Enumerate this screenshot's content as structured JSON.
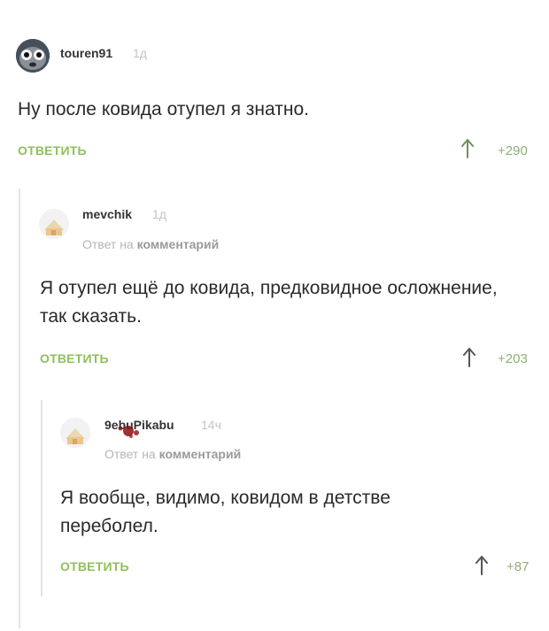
{
  "comments": [
    {
      "username": "touren91",
      "time": "1д",
      "text": "Ну после ковида отупел я знатно.",
      "reply_label": "ОТВЕТИТЬ",
      "rating": "+290"
    },
    {
      "username": "mevchik",
      "time": "1д",
      "reply_to_prefix": "Ответ на",
      "reply_to_target": "комментарий",
      "text": "Я отупел ещё до ковида, предковидное осложнение, так сказать.",
      "reply_label": "ОТВЕТИТЬ",
      "rating": "+203"
    },
    {
      "username": "9ebuPikabu",
      "time": "14ч",
      "reply_to_prefix": "Ответ на",
      "reply_to_target": "комментарий",
      "text": "Я вообще, видимо, ковидом в детстве переболел.",
      "reply_label": "ОТВЕТИТЬ",
      "rating": "+87"
    }
  ],
  "colors": {
    "accent_green": "#8fbf5e",
    "rating_green": "#8fae78",
    "muted": "#b5b5b5",
    "thread_line": "#e4e4e4"
  }
}
